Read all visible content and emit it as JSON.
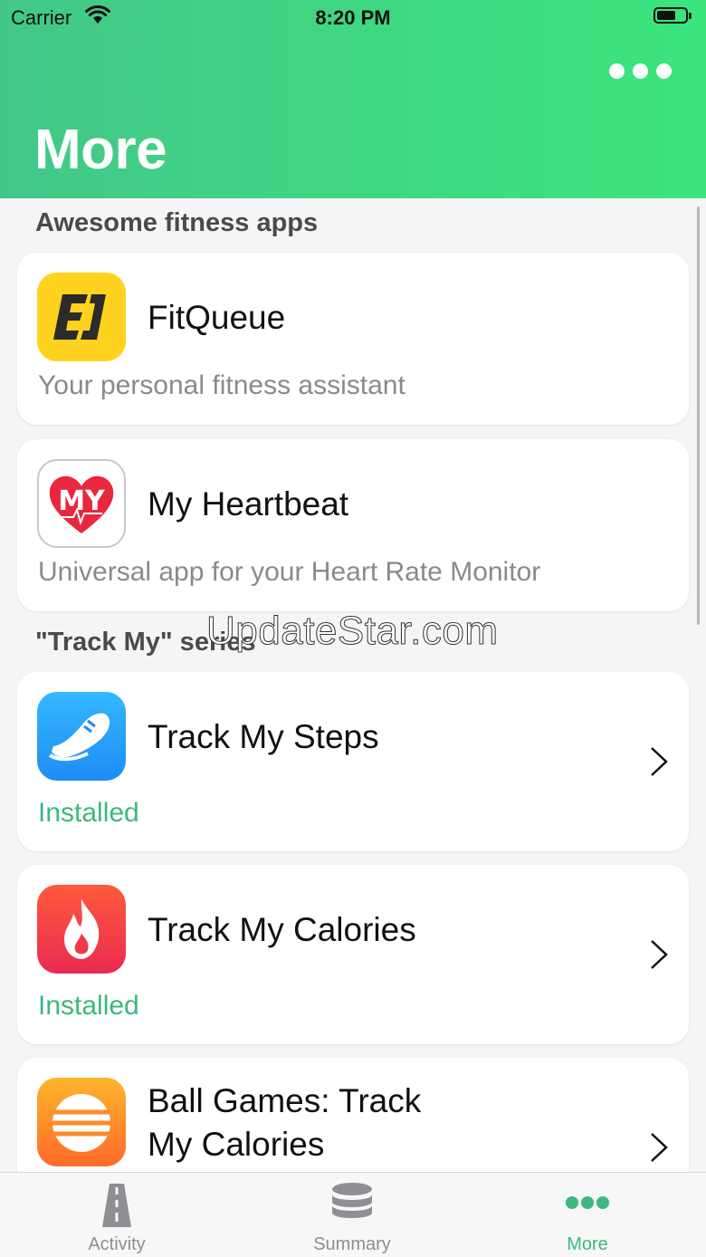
{
  "status_bar": {
    "carrier": "Carrier",
    "time": "8:20 PM"
  },
  "header": {
    "title": "More",
    "menu_icon": "more-dots-icon",
    "gradient": [
      "#43c788",
      "#3be57c"
    ]
  },
  "sections": [
    {
      "title": "Awesome fitness apps",
      "apps": [
        {
          "name": "FitQueue",
          "subtitle": "Your personal fitness assistant",
          "icon": "fitqueue-logo-icon"
        },
        {
          "name": "My Heartbeat",
          "subtitle": "Universal app for your Heart Rate Monitor",
          "icon": "heartbeat-logo-icon"
        }
      ]
    },
    {
      "title": "\"Track My\" series",
      "apps": [
        {
          "name": "Track My Steps",
          "status": "Installed",
          "icon": "sneaker-icon"
        },
        {
          "name": "Track My Calories",
          "status": "Installed",
          "icon": "flame-icon"
        },
        {
          "name_line1": "Ball Games: Track",
          "name_line2": "My Calories",
          "icon": "ball-icon"
        }
      ]
    }
  ],
  "watermark": "UpdateStar.com",
  "tab_bar": {
    "tabs": [
      {
        "label": "Activity",
        "icon": "road-icon"
      },
      {
        "label": "Summary",
        "icon": "database-icon"
      },
      {
        "label": "More",
        "icon": "more-dots-icon",
        "active": true
      }
    ]
  },
  "colors": {
    "accent": "#3cb87f",
    "subtitle": "#8a8a8e"
  }
}
